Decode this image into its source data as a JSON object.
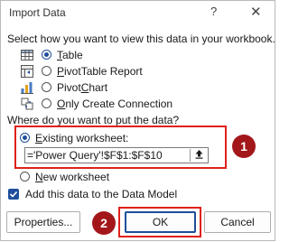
{
  "dialog": {
    "title": "Import Data",
    "help_label": "?",
    "close_label": "✕"
  },
  "view": {
    "prompt": "Select how you want to view this data in your workbook.",
    "options": [
      {
        "label": "Table",
        "underline": "T",
        "rest": "able",
        "selected": true,
        "icon": "table-icon"
      },
      {
        "label": "PivotTable Report",
        "underline": "P",
        "rest": "ivotTable Report",
        "selected": false,
        "icon": "pivottable-icon"
      },
      {
        "label": "PivotChart",
        "pre": "Pivot",
        "underline": "C",
        "rest": "hart",
        "selected": false,
        "icon": "pivotchart-icon"
      },
      {
        "label": "Only Create Connection",
        "underline": "O",
        "rest": "nly Create Connection",
        "selected": false,
        "icon": "connection-icon"
      }
    ]
  },
  "put": {
    "prompt": "Where do you want to put the data?",
    "existing": {
      "underline": "E",
      "rest": "xisting worksheet:",
      "selected": true
    },
    "range_value": "='Power Query'!$F$1:$F$10",
    "new": {
      "underline": "N",
      "rest": "ew worksheet",
      "selected": false
    }
  },
  "data_model": {
    "label": "Add this data to the Data Model",
    "checked": true
  },
  "buttons": {
    "properties": "Properties...",
    "ok": "OK",
    "cancel": "Cancel"
  },
  "annotations": {
    "badge1": "1",
    "badge2": "2"
  },
  "colors": {
    "accent": "#1f4e9c",
    "highlight": "#e0201b",
    "badge": "#a3171b"
  }
}
